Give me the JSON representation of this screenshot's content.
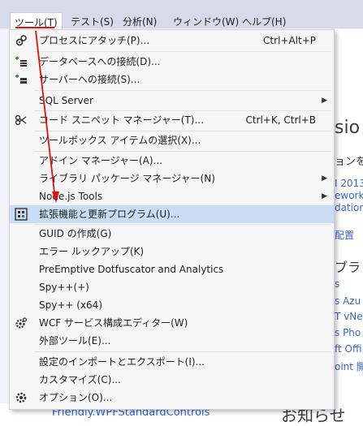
{
  "menubar": {
    "items": [
      "ツール(T)",
      "テスト(S)",
      "分析(N)",
      "ウィンドウ(W)",
      "ヘルプ(H)"
    ]
  },
  "menu": {
    "items": [
      {
        "label": "プロセスにアタッチ(P)...",
        "shortcut": "Ctrl+Alt+P",
        "icon": "attach-process-icon"
      },
      {
        "label": "データベースへの接続(D)...",
        "icon": "database-connect-icon"
      },
      {
        "label": "サーバーへの接続(S)...",
        "icon": "server-connect-icon"
      },
      {
        "label": "SQL Server",
        "submenu": true
      },
      {
        "label": "コード スニペット マネージャー(T)...",
        "shortcut": "Ctrl+K, Ctrl+B",
        "icon": "code-snippet-icon"
      },
      {
        "label": "ツールボックス アイテムの選択(X)..."
      },
      {
        "label": "アドイン マネージャー(A)..."
      },
      {
        "label": "ライブラリ パッケージ マネージャー(N)",
        "submenu": true
      },
      {
        "label": "Node.js Tools",
        "submenu": true
      },
      {
        "label": "拡張機能と更新プログラム(U)...",
        "icon": "extensions-icon",
        "highlighted": true
      },
      {
        "label": "GUID の作成(G)"
      },
      {
        "label": "エラー ルックアップ(K)"
      },
      {
        "label": "PreEmptive Dotfuscator and Analytics"
      },
      {
        "label": "Spy++(+)"
      },
      {
        "label": "Spy++ (x64)"
      },
      {
        "label": "WCF サービス構成エディター(W)",
        "icon": "wcf-gear-icon"
      },
      {
        "label": "外部ツール(E)..."
      },
      {
        "label": "設定のインポートとエクスポート(I)..."
      },
      {
        "label": "カスタマイズ(C)..."
      },
      {
        "label": "オプション(O)...",
        "icon": "options-gear-icon"
      }
    ]
  },
  "background": {
    "heading_fragment": "sio",
    "subheading_fragment": "ョンを",
    "links": [
      "I 2013",
      "ework",
      "dation",
      "配置",
      "ブラ",
      "s",
      "s Azu",
      "T vNe",
      "s Pho",
      "ft Offi",
      "oint 開",
      "Friendly.WPFStandardControls"
    ],
    "footer_big": "お知らせ"
  },
  "colors": {
    "menubar_bg": "#d6dbe9",
    "menu_bg": "#f6f6f6",
    "highlight_bg": "#c9def5",
    "link": "#3b66c4",
    "annotation_red": "#e01010"
  }
}
